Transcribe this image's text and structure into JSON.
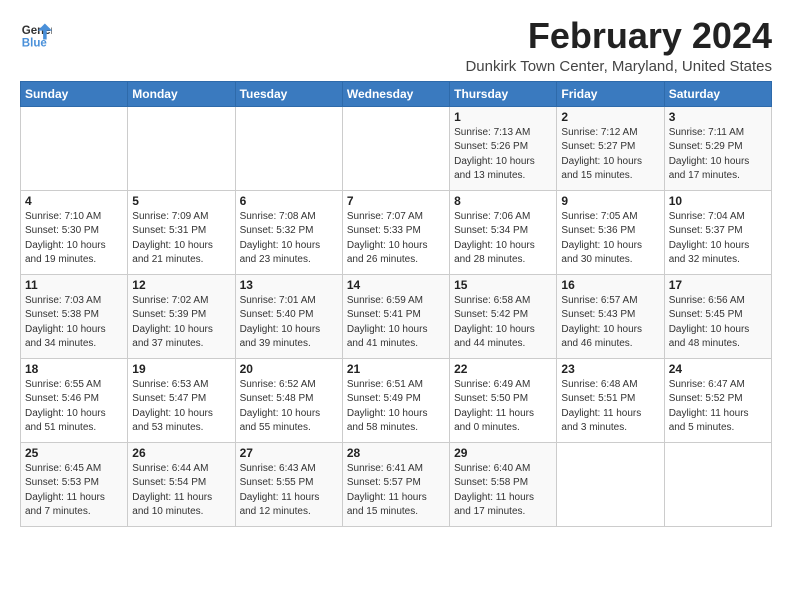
{
  "logo": {
    "line1": "General",
    "line2": "Blue"
  },
  "title": "February 2024",
  "subtitle": "Dunkirk Town Center, Maryland, United States",
  "weekdays": [
    "Sunday",
    "Monday",
    "Tuesday",
    "Wednesday",
    "Thursday",
    "Friday",
    "Saturday"
  ],
  "weeks": [
    [
      {
        "day": "",
        "info": ""
      },
      {
        "day": "",
        "info": ""
      },
      {
        "day": "",
        "info": ""
      },
      {
        "day": "",
        "info": ""
      },
      {
        "day": "1",
        "info": "Sunrise: 7:13 AM\nSunset: 5:26 PM\nDaylight: 10 hours\nand 13 minutes."
      },
      {
        "day": "2",
        "info": "Sunrise: 7:12 AM\nSunset: 5:27 PM\nDaylight: 10 hours\nand 15 minutes."
      },
      {
        "day": "3",
        "info": "Sunrise: 7:11 AM\nSunset: 5:29 PM\nDaylight: 10 hours\nand 17 minutes."
      }
    ],
    [
      {
        "day": "4",
        "info": "Sunrise: 7:10 AM\nSunset: 5:30 PM\nDaylight: 10 hours\nand 19 minutes."
      },
      {
        "day": "5",
        "info": "Sunrise: 7:09 AM\nSunset: 5:31 PM\nDaylight: 10 hours\nand 21 minutes."
      },
      {
        "day": "6",
        "info": "Sunrise: 7:08 AM\nSunset: 5:32 PM\nDaylight: 10 hours\nand 23 minutes."
      },
      {
        "day": "7",
        "info": "Sunrise: 7:07 AM\nSunset: 5:33 PM\nDaylight: 10 hours\nand 26 minutes."
      },
      {
        "day": "8",
        "info": "Sunrise: 7:06 AM\nSunset: 5:34 PM\nDaylight: 10 hours\nand 28 minutes."
      },
      {
        "day": "9",
        "info": "Sunrise: 7:05 AM\nSunset: 5:36 PM\nDaylight: 10 hours\nand 30 minutes."
      },
      {
        "day": "10",
        "info": "Sunrise: 7:04 AM\nSunset: 5:37 PM\nDaylight: 10 hours\nand 32 minutes."
      }
    ],
    [
      {
        "day": "11",
        "info": "Sunrise: 7:03 AM\nSunset: 5:38 PM\nDaylight: 10 hours\nand 34 minutes."
      },
      {
        "day": "12",
        "info": "Sunrise: 7:02 AM\nSunset: 5:39 PM\nDaylight: 10 hours\nand 37 minutes."
      },
      {
        "day": "13",
        "info": "Sunrise: 7:01 AM\nSunset: 5:40 PM\nDaylight: 10 hours\nand 39 minutes."
      },
      {
        "day": "14",
        "info": "Sunrise: 6:59 AM\nSunset: 5:41 PM\nDaylight: 10 hours\nand 41 minutes."
      },
      {
        "day": "15",
        "info": "Sunrise: 6:58 AM\nSunset: 5:42 PM\nDaylight: 10 hours\nand 44 minutes."
      },
      {
        "day": "16",
        "info": "Sunrise: 6:57 AM\nSunset: 5:43 PM\nDaylight: 10 hours\nand 46 minutes."
      },
      {
        "day": "17",
        "info": "Sunrise: 6:56 AM\nSunset: 5:45 PM\nDaylight: 10 hours\nand 48 minutes."
      }
    ],
    [
      {
        "day": "18",
        "info": "Sunrise: 6:55 AM\nSunset: 5:46 PM\nDaylight: 10 hours\nand 51 minutes."
      },
      {
        "day": "19",
        "info": "Sunrise: 6:53 AM\nSunset: 5:47 PM\nDaylight: 10 hours\nand 53 minutes."
      },
      {
        "day": "20",
        "info": "Sunrise: 6:52 AM\nSunset: 5:48 PM\nDaylight: 10 hours\nand 55 minutes."
      },
      {
        "day": "21",
        "info": "Sunrise: 6:51 AM\nSunset: 5:49 PM\nDaylight: 10 hours\nand 58 minutes."
      },
      {
        "day": "22",
        "info": "Sunrise: 6:49 AM\nSunset: 5:50 PM\nDaylight: 11 hours\nand 0 minutes."
      },
      {
        "day": "23",
        "info": "Sunrise: 6:48 AM\nSunset: 5:51 PM\nDaylight: 11 hours\nand 3 minutes."
      },
      {
        "day": "24",
        "info": "Sunrise: 6:47 AM\nSunset: 5:52 PM\nDaylight: 11 hours\nand 5 minutes."
      }
    ],
    [
      {
        "day": "25",
        "info": "Sunrise: 6:45 AM\nSunset: 5:53 PM\nDaylight: 11 hours\nand 7 minutes."
      },
      {
        "day": "26",
        "info": "Sunrise: 6:44 AM\nSunset: 5:54 PM\nDaylight: 11 hours\nand 10 minutes."
      },
      {
        "day": "27",
        "info": "Sunrise: 6:43 AM\nSunset: 5:55 PM\nDaylight: 11 hours\nand 12 minutes."
      },
      {
        "day": "28",
        "info": "Sunrise: 6:41 AM\nSunset: 5:57 PM\nDaylight: 11 hours\nand 15 minutes."
      },
      {
        "day": "29",
        "info": "Sunrise: 6:40 AM\nSunset: 5:58 PM\nDaylight: 11 hours\nand 17 minutes."
      },
      {
        "day": "",
        "info": ""
      },
      {
        "day": "",
        "info": ""
      }
    ]
  ]
}
